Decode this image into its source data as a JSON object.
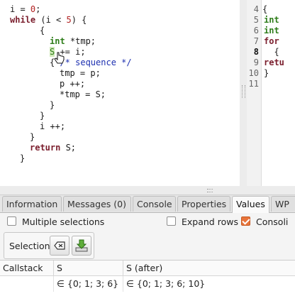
{
  "code": {
    "lines": [
      {
        "parts": [
          {
            "t": "i = ",
            "c": ""
          },
          {
            "t": "0",
            "c": "num"
          },
          {
            "t": ";",
            "c": ""
          }
        ]
      },
      {
        "parts": [
          {
            "t": "while",
            "c": "kw"
          },
          {
            "t": " (i < ",
            "c": ""
          },
          {
            "t": "5",
            "c": "num"
          },
          {
            "t": ") {",
            "c": ""
          }
        ]
      },
      {
        "parts": [
          {
            "t": "{",
            "c": ""
          }
        ]
      },
      {
        "parts": [
          {
            "t": "int",
            "c": "ty"
          },
          {
            "t": " *tmp;",
            "c": ""
          }
        ]
      },
      {
        "parts": [
          {
            "t": "S",
            "c": "hl"
          },
          {
            "t": " += i;",
            "c": ""
          }
        ]
      },
      {
        "parts": [
          {
            "t": "{ ",
            "c": ""
          },
          {
            "t": "/* sequence */",
            "c": "cm"
          }
        ]
      },
      {
        "parts": [
          {
            "t": "tmp = p;",
            "c": ""
          }
        ]
      },
      {
        "parts": [
          {
            "t": "p ++;",
            "c": ""
          }
        ]
      },
      {
        "parts": [
          {
            "t": "*tmp = S;",
            "c": ""
          }
        ]
      },
      {
        "parts": [
          {
            "t": "}",
            "c": ""
          }
        ]
      },
      {
        "parts": [
          {
            "t": "}",
            "c": ""
          }
        ]
      },
      {
        "parts": [
          {
            "t": "i ++;",
            "c": ""
          }
        ]
      },
      {
        "parts": [
          {
            "t": "}",
            "c": ""
          }
        ]
      },
      {
        "parts": [
          {
            "t": "return",
            "c": "kw"
          },
          {
            "t": " S;",
            "c": ""
          }
        ]
      },
      {
        "parts": [
          {
            "t": "}",
            "c": ""
          }
        ]
      }
    ]
  },
  "right_code": {
    "line_numbers": [
      "4",
      "5",
      "6",
      "7",
      "8",
      "9",
      "10",
      "11"
    ],
    "current_line": "8",
    "lines": [
      {
        "parts": [
          {
            "t": "{",
            "c": ""
          }
        ]
      },
      {
        "parts": [
          {
            "t": "int",
            "c": "ty"
          }
        ]
      },
      {
        "parts": [
          {
            "t": "int",
            "c": "ty"
          }
        ]
      },
      {
        "parts": [
          {
            "t": "for",
            "c": "kw"
          }
        ]
      },
      {
        "parts": [
          {
            "t": "  {",
            "c": ""
          }
        ]
      },
      {
        "parts": [
          {
            "t": "retu",
            "c": "kw"
          }
        ]
      },
      {
        "parts": [
          {
            "t": "}",
            "c": ""
          }
        ]
      },
      {
        "parts": [
          {
            "t": "",
            "c": ""
          }
        ]
      }
    ]
  },
  "tabs": [
    "Information",
    "Messages (0)",
    "Console",
    "Properties",
    "Values",
    "WP"
  ],
  "active_tab": "Values",
  "options": {
    "multiple_selections": "Multiple selections",
    "expand_rows": "Expand rows",
    "consolidated": "Consoli"
  },
  "selection": {
    "label": "Selection",
    "clear_icon": "clear-selection-icon",
    "pin_icon": "download-tray-icon"
  },
  "table": {
    "headers": [
      "Callstack",
      "S",
      "S (after)"
    ],
    "rows": [
      [
        "",
        "∈ {0; 1; 3; 6}",
        "∈ {0; 1; 3; 6; 10}"
      ]
    ]
  },
  "colors": {
    "keyword": "#7a1d2c",
    "type": "#2e7d1a",
    "comment": "#1c2fb0",
    "number": "#b22222",
    "highlight": "#cfe8b8",
    "checked": "#e8743b"
  }
}
